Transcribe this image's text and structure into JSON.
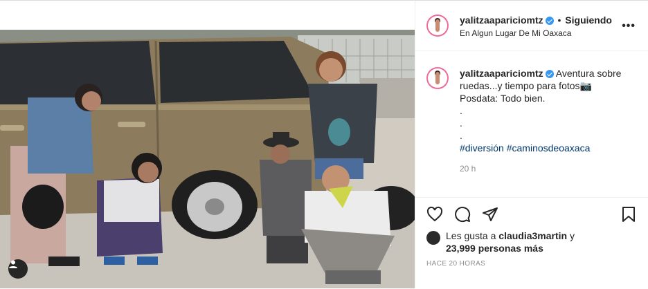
{
  "header": {
    "username": "yalitzaapariciomtz",
    "separator": "•",
    "follow_status": "Siguiendo",
    "location": "En Algun Lugar De Mi Oaxaca"
  },
  "caption": {
    "username": "yalitzaapariciomtz",
    "line1": "Aventura sobre ruedas...y tiempo para fotos📷",
    "line2": "Posdata: Todo bien.",
    "dot1": ".",
    "dot2": ".",
    "dot3": ".",
    "hashtag1": "#diversión",
    "hashtag2": "#caminosdeoaxaca",
    "time": "20 h"
  },
  "likes": {
    "prefix": "Les gusta a",
    "user": "claudia3martin",
    "conj": "y",
    "count_text": "23,999 personas más"
  },
  "posted_ago": "HACE 20 HORAS",
  "icons": [
    "heart-icon",
    "comment-icon",
    "share-icon",
    "bookmark-icon",
    "more-icon",
    "verified-badge-icon",
    "user-tag-icon"
  ],
  "colors": {
    "link": "#00376b",
    "verified": "#3897f0",
    "secondary": "#8e8e8e"
  }
}
